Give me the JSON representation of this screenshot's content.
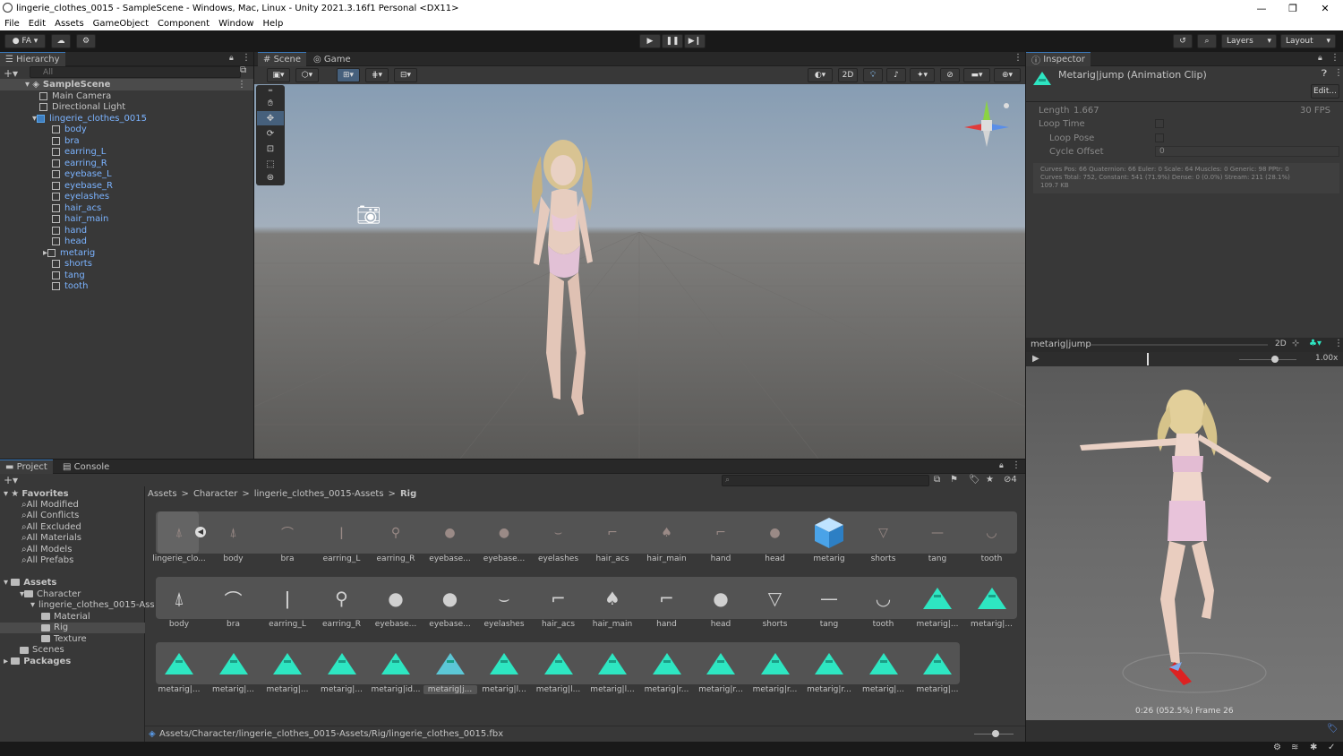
{
  "window": {
    "title": "lingerie_clothes_0015 - SampleScene - Windows, Mac, Linux - Unity 2021.3.16f1 Personal <DX11>",
    "controls": [
      "—",
      "❐",
      "✕"
    ]
  },
  "menu": [
    "File",
    "Edit",
    "Assets",
    "GameObject",
    "Component",
    "Window",
    "Help"
  ],
  "toolbar": {
    "account": "FA",
    "layers": "Layers",
    "layout": "Layout"
  },
  "hierarchy": {
    "tab": "Hierarchy",
    "search_placeholder": "All",
    "scene": "SampleScene",
    "items": [
      {
        "label": "Main Camera",
        "kind": "white"
      },
      {
        "label": "Directional Light",
        "kind": "white"
      },
      {
        "label": "lingerie_clothes_0015",
        "kind": "prefab"
      },
      {
        "label": "body",
        "kind": "child"
      },
      {
        "label": "bra",
        "kind": "child"
      },
      {
        "label": "earring_L",
        "kind": "child"
      },
      {
        "label": "earring_R",
        "kind": "child"
      },
      {
        "label": "eyebase_L",
        "kind": "child"
      },
      {
        "label": "eyebase_R",
        "kind": "child"
      },
      {
        "label": "eyelashes",
        "kind": "child"
      },
      {
        "label": "hair_acs",
        "kind": "child"
      },
      {
        "label": "hair_main",
        "kind": "child"
      },
      {
        "label": "hand",
        "kind": "child"
      },
      {
        "label": "head",
        "kind": "child"
      },
      {
        "label": "metarig",
        "kind": "child"
      },
      {
        "label": "shorts",
        "kind": "child"
      },
      {
        "label": "tang",
        "kind": "child"
      },
      {
        "label": "tooth",
        "kind": "child"
      }
    ]
  },
  "scene_tabs": {
    "scene": "Scene",
    "game": "Game",
    "two_d": "2D"
  },
  "inspector": {
    "tab": "Inspector",
    "title": "Metarig|jump (Animation Clip)",
    "edit": "Edit...",
    "length_label": "Length",
    "length_value": "1.667",
    "fps": "30 FPS",
    "loop_time": "Loop Time",
    "loop_pose": "Loop Pose",
    "cycle_offset": "Cycle Offset",
    "cycle_offset_value": "0",
    "info_lines": [
      "Curves Pos: 66 Quaternion: 66 Euler: 0 Scale: 64 Muscles: 0 Generic: 98 PPtr: 0",
      "Curves Total: 752, Constant: 541 (71.9%) Dense: 0 (0.0%) Stream: 211 (28.1%)",
      "109.7 KB"
    ],
    "preview_clip": "metarig|jump",
    "preview_2d": "2D",
    "speed": "1.00x",
    "preview_status": "0:26 (052.5%) Frame 26"
  },
  "project": {
    "tab_project": "Project",
    "tab_console": "Console",
    "hidden_count": "4",
    "favorites_label": "Favorites",
    "favorites": [
      "All Modified",
      "All Conflicts",
      "All Excluded",
      "All Materials",
      "All Models",
      "All Prefabs"
    ],
    "assets_label": "Assets",
    "tree": [
      {
        "label": "Character",
        "indent": 1
      },
      {
        "label": "lingerie_clothes_0015-Ass",
        "indent": 2
      },
      {
        "label": "Material",
        "indent": 3
      },
      {
        "label": "Rig",
        "indent": 3,
        "selected": true
      },
      {
        "label": "Texture",
        "indent": 3
      },
      {
        "label": "Scenes",
        "indent": 1
      }
    ],
    "packages_label": "Packages",
    "breadcrumb": [
      "Assets",
      "Character",
      "lingerie_clothes_0015-Assets",
      "Rig"
    ],
    "row1": [
      "lingerie_clo...",
      "body",
      "bra",
      "earring_L",
      "earring_R",
      "eyebase...",
      "eyebase...",
      "eyelashes",
      "hair_acs",
      "hair_main",
      "hand",
      "head",
      "metarig",
      "shorts",
      "tang",
      "tooth"
    ],
    "row2": [
      "body",
      "bra",
      "earring_L",
      "earring_R",
      "eyebase...",
      "eyebase...",
      "eyelashes",
      "hair_acs",
      "hair_main",
      "hand",
      "head",
      "shorts",
      "tang",
      "tooth",
      "metarig|...",
      "metarig|..."
    ],
    "row3": [
      "metarig|...",
      "metarig|...",
      "metarig|...",
      "metarig|...",
      "metarig|id...",
      "metarig|j...",
      "metarig|l...",
      "metarig|l...",
      "metarig|l...",
      "metarig|r...",
      "metarig|r...",
      "metarig|r...",
      "metarig|r...",
      "metarig|...",
      "metarig|..."
    ],
    "status_path": "Assets/Character/lingerie_clothes_0015-Assets/Rig/lingerie_clothes_0015.fbx"
  }
}
